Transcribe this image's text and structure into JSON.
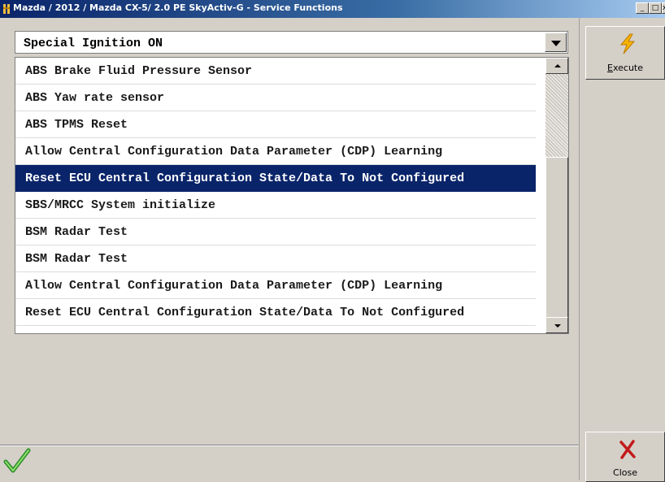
{
  "window": {
    "title": "Mazda / 2012 / Mazda CX-5/ 2.0 PE SkyActiv-G - Service Functions",
    "min_glyph": "_",
    "max_glyph": "□",
    "close_glyph": "x"
  },
  "combo": {
    "selected": "Special Ignition ON"
  },
  "functions": {
    "selected_index": 4,
    "items": [
      "ABS Brake Fluid Pressure Sensor",
      "ABS Yaw rate sensor",
      "ABS TPMS Reset",
      "Allow Central Configuration Data Parameter (CDP) Learning",
      "Reset ECU Central Configuration State/Data To Not Configured",
      "SBS/MRCC System initialize",
      "BSM Radar Test",
      "BSM Radar Test",
      "Allow Central Configuration Data Parameter (CDP) Learning",
      "Reset ECU Central Configuration State/Data To Not Configured"
    ]
  },
  "actions": {
    "execute_label": "Execute",
    "close_label": "Close",
    "execute_icon": "lightning-icon",
    "close_icon": "red-x-icon"
  },
  "status": {
    "icon": "green-checkmark-icon"
  },
  "colors": {
    "selection": "#0a246a",
    "titlebar_start": "#0a246a",
    "titlebar_end": "#a6caf0",
    "panel": "#d4d0c8"
  }
}
